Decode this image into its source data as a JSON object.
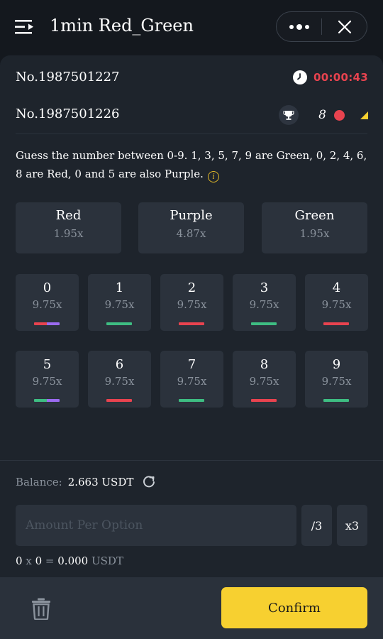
{
  "header": {
    "title": "1min Red_Green"
  },
  "round": {
    "current_issue": "No.1987501227",
    "countdown": "00:00:43",
    "previous_issue": "No.1987501226",
    "previous_result_number": "8",
    "previous_result_color": "#e8434f"
  },
  "description": "Guess the number between 0-9. 1, 3, 5, 7, 9 are Green, 0, 2, 4, 6, 8 are Red, 0 and 5 are also Purple.",
  "colors": {
    "red": "#e8434f",
    "green": "#3ebd82",
    "purple": "#9b6bf0",
    "confirm": "#f7d030"
  },
  "color_options": [
    {
      "name": "Red",
      "odds": "1.95x"
    },
    {
      "name": "Purple",
      "odds": "4.87x"
    },
    {
      "name": "Green",
      "odds": "1.95x"
    }
  ],
  "number_options": [
    {
      "number": "0",
      "odds": "9.75x",
      "bar": [
        "red",
        "purple"
      ]
    },
    {
      "number": "1",
      "odds": "9.75x",
      "bar": [
        "green"
      ]
    },
    {
      "number": "2",
      "odds": "9.75x",
      "bar": [
        "red"
      ]
    },
    {
      "number": "3",
      "odds": "9.75x",
      "bar": [
        "green"
      ]
    },
    {
      "number": "4",
      "odds": "9.75x",
      "bar": [
        "red"
      ]
    },
    {
      "number": "5",
      "odds": "9.75x",
      "bar": [
        "green",
        "purple"
      ]
    },
    {
      "number": "6",
      "odds": "9.75x",
      "bar": [
        "red"
      ]
    },
    {
      "number": "7",
      "odds": "9.75x",
      "bar": [
        "green"
      ]
    },
    {
      "number": "8",
      "odds": "9.75x",
      "bar": [
        "red"
      ]
    },
    {
      "number": "9",
      "odds": "9.75x",
      "bar": [
        "green"
      ]
    }
  ],
  "bet": {
    "balance_label": "Balance:",
    "balance_value": "2.663 USDT",
    "amount_placeholder": "Amount Per Option",
    "amount_value": "",
    "divide_label": "/3",
    "multiply_label": "x3",
    "summary_count": "0",
    "summary_x": "x",
    "summary_amount": "0",
    "summary_eq": "=",
    "summary_total": "0.000",
    "summary_currency": "USDT"
  },
  "footer": {
    "confirm_label": "Confirm"
  },
  "icons": {
    "menu": "menu-icon",
    "more": "more-icon",
    "close": "close-icon",
    "clock": "clock-icon",
    "trophy": "trophy-icon",
    "info": "info-icon",
    "refresh": "refresh-icon",
    "trash": "trash-icon"
  }
}
